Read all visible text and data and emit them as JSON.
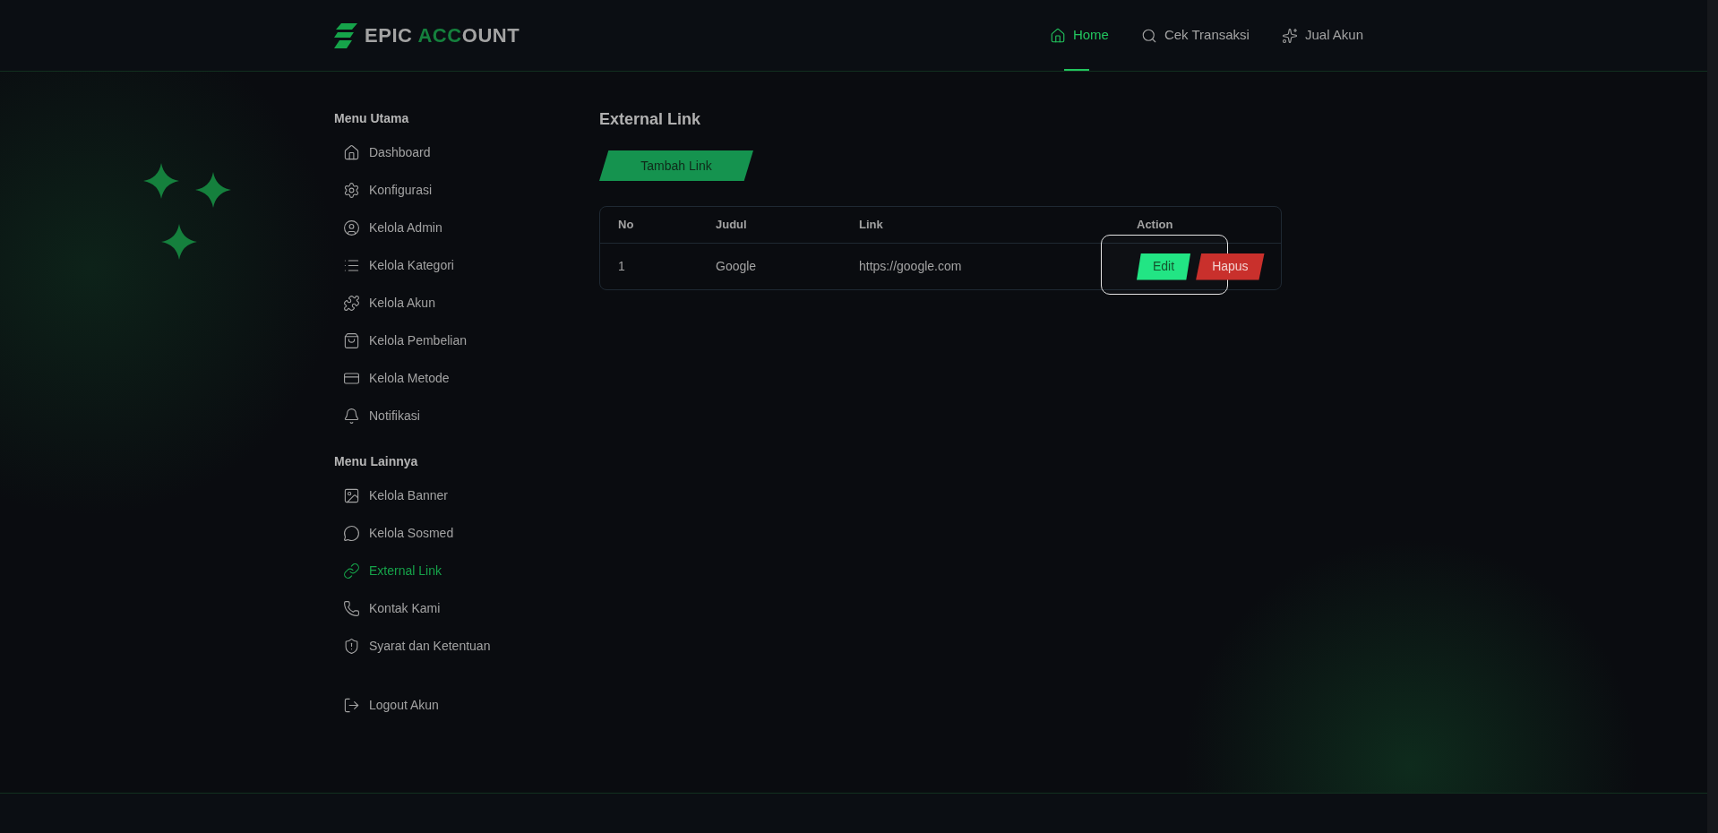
{
  "header": {
    "logo": [
      {
        "text": "EPIC ",
        "highlight": false
      },
      {
        "text": "ACC",
        "highlight": true
      },
      {
        "text": "OUNT",
        "highlight": false
      }
    ],
    "nav": [
      {
        "label": "Home",
        "selected": true
      },
      {
        "label": "Cek Transaksi",
        "selected": false
      },
      {
        "label": "Jual Akun",
        "selected": false
      }
    ]
  },
  "sidebar": {
    "sections": [
      {
        "title": "Menu Utama",
        "items": [
          {
            "label": "Dashboard",
            "selected": false
          },
          {
            "label": "Konfigurasi",
            "selected": false
          },
          {
            "label": "Kelola Admin",
            "selected": false
          },
          {
            "label": "Kelola Kategori",
            "selected": false
          },
          {
            "label": "Kelola Akun",
            "selected": false
          },
          {
            "label": "Kelola Pembelian",
            "selected": false
          },
          {
            "label": "Kelola Metode",
            "selected": false
          },
          {
            "label": "Notifikasi",
            "selected": false
          }
        ]
      },
      {
        "title": "Menu Lainnya",
        "items": [
          {
            "label": "Kelola Banner",
            "selected": false
          },
          {
            "label": "Kelola Sosmed",
            "selected": false
          },
          {
            "label": "External Link",
            "selected": true
          },
          {
            "label": "Kontak Kami",
            "selected": false
          },
          {
            "label": "Syarat dan Ketentuan",
            "selected": false
          }
        ]
      }
    ],
    "logout": "Logout Akun"
  },
  "page": {
    "title": "External Link",
    "add_button": "Tambah Link",
    "table": {
      "columns": [
        "No",
        "Judul",
        "Link",
        "Action"
      ],
      "rows": [
        {
          "no": "1",
          "judul": "Google",
          "link": "https://google.com",
          "actions": [
            {
              "label": "Edit",
              "kind": "edit",
              "focused": true
            },
            {
              "label": "Hapus",
              "kind": "delete",
              "focused": false
            }
          ]
        }
      ]
    }
  }
}
